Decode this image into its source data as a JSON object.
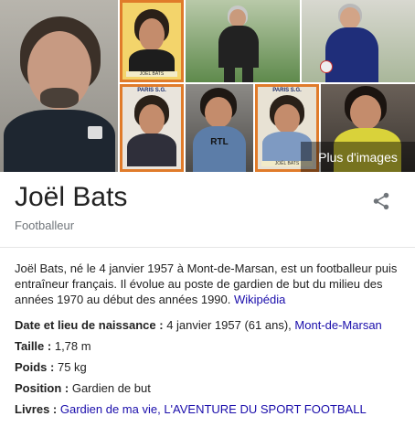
{
  "gallery": {
    "more_label": "Plus d'images",
    "cards": [
      {
        "top_label": "",
        "name_label": "JOËL BATS"
      },
      {
        "top_label": "PARIS S.G.",
        "name_label": ""
      },
      {
        "top_label": "PARIS S.G.",
        "name_label": "JOËL BATS"
      }
    ],
    "shirt_text": "RTL"
  },
  "entity": {
    "name": "Joël Bats",
    "type": "Footballeur"
  },
  "description": {
    "text": "Joël Bats, né le 4 janvier 1957 à Mont-de-Marsan, est un footballeur puis entraîneur français. Il évolue au poste de gardien de but du milieu des années 1970 au début des années 1990.",
    "source": "Wikipédia"
  },
  "facts": [
    {
      "key": "Date et lieu de naissance",
      "value": "4 janvier 1957 (61 ans),",
      "link": "Mont-de-Marsan"
    },
    {
      "key": "Taille",
      "value": "1,78 m",
      "link": ""
    },
    {
      "key": "Poids",
      "value": "75 kg",
      "link": ""
    },
    {
      "key": "Position",
      "value": "Gardien de but",
      "link": ""
    },
    {
      "key": "Livres",
      "value": "",
      "link": "Gardien de ma vie, L'AVENTURE DU SPORT FOOTBALL"
    }
  ],
  "colors": {
    "link": "#1a0dab",
    "muted": "#70757a",
    "card_frame": "#e07b2a"
  }
}
